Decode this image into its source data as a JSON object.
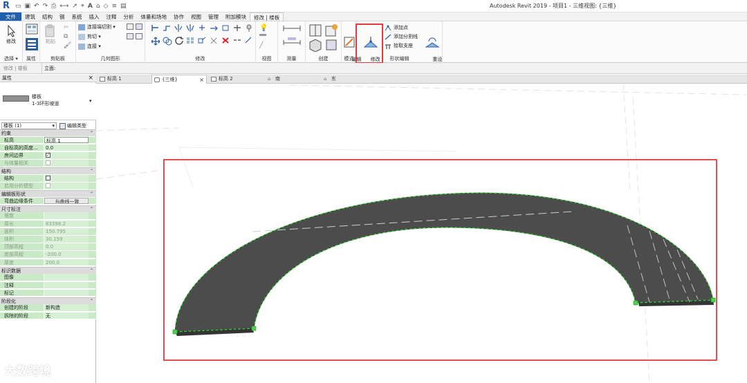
{
  "app": {
    "title": "Autodesk Revit 2019 - 项目1 - 三维视图: {三维}",
    "logo": "R"
  },
  "menu": {
    "tabs": [
      "文件",
      "建筑",
      "结构",
      "钢",
      "系统",
      "插入",
      "注释",
      "分析",
      "体量和场地",
      "协作",
      "视图",
      "管理",
      "附加模块",
      "修改 | 楼板"
    ]
  },
  "ribbon": {
    "select": {
      "label": "修改",
      "panel": "选择 ▾"
    },
    "properties": {
      "panel": "属性"
    },
    "clipboard": {
      "paste": "粘贴",
      "panel": "剪贴板"
    },
    "geometry": {
      "join_cut": "连接端切割 ▾",
      "cut": "剪切 ▾",
      "join": "连接 ▾",
      "panel": "几何图形"
    },
    "modify": {
      "panel": "修改"
    },
    "view": {
      "panel": "视图"
    },
    "measure": {
      "panel": "测量"
    },
    "create": {
      "panel": "创建"
    },
    "mode": {
      "edit_boundary": "编辑\n边界",
      "panel": "模式"
    },
    "shape_edit": {
      "modify_sub": "修改\n子图元",
      "add_point": "添加点",
      "add_split": "添加分割线",
      "pick_support": "拾取支座",
      "reset_shape": "重设\n形状",
      "panel": "形状编辑"
    }
  },
  "optionbar": {
    "left": "修改 | 楼板",
    "label": "立面:"
  },
  "viewtabs": [
    {
      "label": "标高 1"
    },
    {
      "label": "{三维}",
      "close": "×"
    },
    {
      "label": "标高 2"
    },
    {
      "label": "南"
    },
    {
      "label": "东"
    }
  ],
  "properties": {
    "title": "属性",
    "close": "×",
    "type_family": "楼板",
    "type_name": "1-3环形坡道",
    "selector": "楼板 (1)",
    "edit_type": "编辑类型",
    "sections": [
      {
        "name": "约束",
        "caret": "⌃",
        "rows": [
          {
            "k": "标高",
            "v": "标高 1"
          },
          {
            "k": "自标高的高度...",
            "v": "0.0"
          },
          {
            "k": "房间边界",
            "check": true
          },
          {
            "k": "与体量相关",
            "check": false,
            "dim": true
          }
        ]
      },
      {
        "name": "结构",
        "caret": "⌃",
        "rows": [
          {
            "k": "结构",
            "check": false
          },
          {
            "k": "启用分析模型",
            "check": false,
            "dim": true
          }
        ]
      },
      {
        "name": "编辑板形状",
        "caret": "⌃",
        "rows": [
          {
            "k": "弯曲边缘条件",
            "v": "与曲线一致",
            "button": true
          }
        ]
      },
      {
        "name": "尺寸标注",
        "caret": "⌃",
        "rows": [
          {
            "k": "坡度",
            "v": "",
            "dim": true
          },
          {
            "k": "周长",
            "v": "83398.2",
            "dim": true
          },
          {
            "k": "面积",
            "v": "150.795",
            "dim": true
          },
          {
            "k": "体积",
            "v": "30.159",
            "dim": true
          },
          {
            "k": "顶部高程",
            "v": "0.0",
            "dim": true
          },
          {
            "k": "底部高程",
            "v": "-200.0",
            "dim": true
          },
          {
            "k": "厚度",
            "v": "200.0",
            "dim": true
          }
        ]
      },
      {
        "name": "标识数据",
        "caret": "⌃",
        "rows": [
          {
            "k": "图像",
            "v": ""
          },
          {
            "k": "注释",
            "v": ""
          },
          {
            "k": "标记",
            "v": ""
          }
        ]
      },
      {
        "name": "阶段化",
        "caret": "⌃",
        "rows": [
          {
            "k": "创建的阶段",
            "v": "新构造"
          },
          {
            "k": "拆除的阶段",
            "v": "无"
          }
        ]
      }
    ]
  },
  "watermark": "大数跨境",
  "colors": {
    "accent": "#1f5fad",
    "highlight": "#e13b3b",
    "slab": "#4a4a4a",
    "sketch": "#33cc33",
    "prop_green": "#c9e9c7"
  }
}
